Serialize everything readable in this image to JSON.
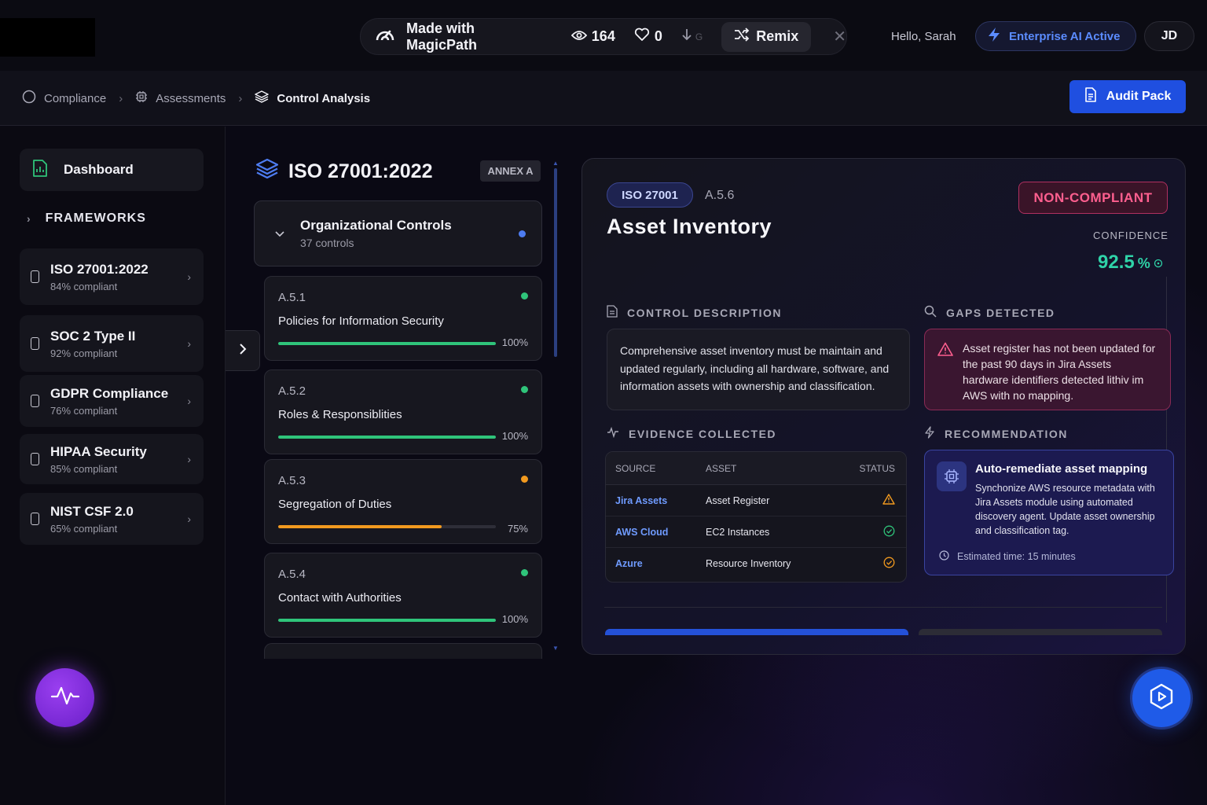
{
  "topbar": {
    "made_with": "Made with MagicPath",
    "views": "164",
    "likes": "0",
    "download_letter": "G",
    "remix_label": "Remix",
    "greeting": "Hello, Sarah",
    "enterprise_label": "Enterprise AI Active",
    "avatar_initials": "JD"
  },
  "breadcrumb": {
    "items": [
      "Compliance",
      "Assessments",
      "Control Analysis"
    ],
    "audit_button": "Audit Pack"
  },
  "sidebar": {
    "dashboard_label": "Dashboard",
    "frameworks_header": "FRAMEWORKS",
    "frameworks": [
      {
        "name": "ISO 27001:2022",
        "compliance": "84% compliant"
      },
      {
        "name": "SOC 2 Type II",
        "compliance": "92% compliant"
      },
      {
        "name": "GDPR Compliance",
        "compliance": "76% compliant"
      },
      {
        "name": "HIPAA Security",
        "compliance": "85% compliant"
      },
      {
        "name": "NIST CSF 2.0",
        "compliance": "65% compliant"
      }
    ]
  },
  "controls": {
    "title": "ISO 27001:2022",
    "badge": "ANNEX A",
    "group": {
      "name": "Organizational Controls",
      "count": "37 controls"
    },
    "items": [
      {
        "code": "A.5.1",
        "name": "Policies for Information Security",
        "progress": 100,
        "progress_label": "100%",
        "status_color": "#2fc47a"
      },
      {
        "code": "A.5.2",
        "name": "Roles & Responsiblities",
        "progress": 100,
        "progress_label": "100%",
        "status_color": "#2fc47a"
      },
      {
        "code": "A.5.3",
        "name": "Segregation of Duties",
        "progress": 75,
        "progress_label": "75%",
        "status_color": "#f29a1f"
      },
      {
        "code": "A.5.4",
        "name": "Contact with Authorities",
        "progress": 100,
        "progress_label": "100%",
        "status_color": "#2fc47a"
      }
    ]
  },
  "detail": {
    "framework_tag": "ISO 27001",
    "control_id": "A.5.6",
    "title": "Asset Inventory",
    "status_badge": "NON-COMPLIANT",
    "confidence_label": "CONFIDENCE",
    "confidence_value": "92.5",
    "confidence_unit": "%",
    "description_header": "CONTROL DESCRIPTION",
    "description": "Comprehensive asset inventory must be maintain and updated regularly, including all hardware, software, and information assets with ownership and classification.",
    "gaps_header": "GAPS DETECTED",
    "gap_text": "Asset register has not been updated for the past 90 days in Jira Assets hardware identifiers detected lithiv im AWS with no mapping.",
    "evidence_header": "EVIDENCE COLLECTED",
    "evidence_columns": [
      "SOURCE",
      "ASSET",
      "STATUS"
    ],
    "evidence_rows": [
      {
        "source": "Jira Assets",
        "asset": "Asset Register",
        "status": "warning"
      },
      {
        "source": "AWS Cloud",
        "asset": "EC2 Instances",
        "status": "ok"
      },
      {
        "source": "Azure",
        "asset": "Resource Inventory",
        "status": "pending"
      }
    ],
    "recommendation_header": "RECOMMENDATION",
    "rec_title": "Auto-remediate asset mapping",
    "rec_text": "Synchonize AWS resource metadata with Jira Assets module using automated discovery agent. Update asset ownership and classification tag.",
    "rec_eta": "Estimated time: 15 minutes"
  },
  "colors": {
    "accent_blue": "#1f4fe0",
    "success": "#2fc47a",
    "warning": "#f29a1f",
    "danger": "#ff5f8f",
    "confidence": "#2fd3a8"
  }
}
